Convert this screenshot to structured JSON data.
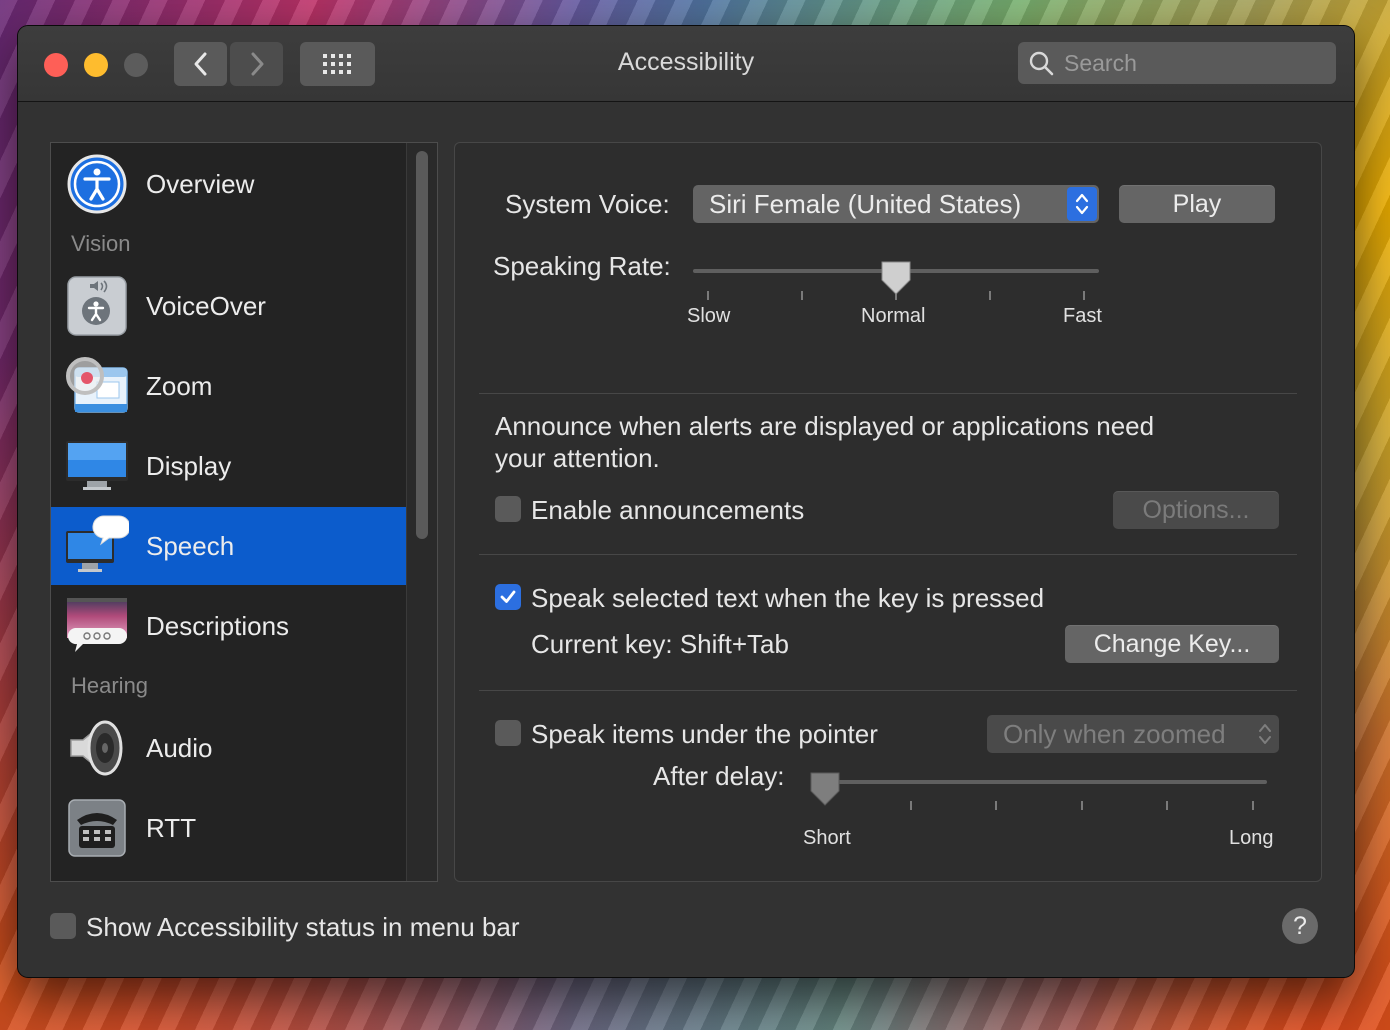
{
  "window": {
    "title": "Accessibility"
  },
  "search": {
    "placeholder": "Search"
  },
  "sidebar": {
    "items": [
      {
        "label": "Overview",
        "icon": "accessibility-icon"
      },
      {
        "label": "VoiceOver",
        "icon": "voiceover-icon"
      },
      {
        "label": "Zoom",
        "icon": "zoom-icon"
      },
      {
        "label": "Display",
        "icon": "display-icon"
      },
      {
        "label": "Speech",
        "icon": "speech-icon",
        "selected": true
      },
      {
        "label": "Descriptions",
        "icon": "descriptions-icon"
      },
      {
        "label": "Audio",
        "icon": "speaker-icon"
      },
      {
        "label": "RTT",
        "icon": "telephone-icon"
      }
    ],
    "sections": {
      "vision": "Vision",
      "hearing": "Hearing"
    }
  },
  "speech": {
    "system_voice_label": "System Voice:",
    "system_voice_value": "Siri Female (United States)",
    "play_label": "Play",
    "speaking_rate_label": "Speaking Rate:",
    "rate_slow": "Slow",
    "rate_normal": "Normal",
    "rate_fast": "Fast",
    "speaking_rate_value": 0.5,
    "announce_text_line1": "Announce when alerts are displayed or applications need",
    "announce_text_line2": "your attention.",
    "enable_announcements_label": "Enable announcements",
    "enable_announcements_checked": false,
    "options_label": "Options...",
    "speak_selected_label": "Speak selected text when the key is pressed",
    "speak_selected_checked": true,
    "current_key_label": "Current key: Shift+Tab",
    "change_key_label": "Change Key...",
    "speak_pointer_label": "Speak items under the pointer",
    "speak_pointer_checked": false,
    "pointer_mode_value": "Only when zoomed",
    "after_delay_label": "After delay:",
    "delay_short": "Short",
    "delay_long": "Long",
    "delay_value": 0.0
  },
  "footer": {
    "status_menu_label": "Show Accessibility status in menu bar",
    "status_menu_checked": false,
    "help_label": "?"
  },
  "colors": {
    "accent": "#0c5ccc",
    "checkbox_blue": "#2c6fe0",
    "window_bg": "#323232"
  }
}
